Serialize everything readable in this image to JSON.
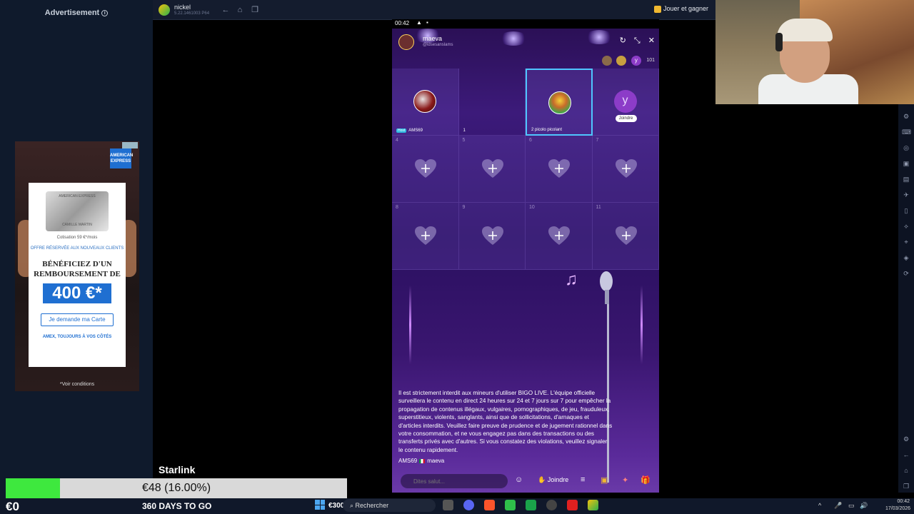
{
  "ad": {
    "label": "Advertisement",
    "brand": "AMERICAN EXPRESS",
    "card_brand": "AMERICAN EXPRESS",
    "card_holder": "CAMILLE MARTIN",
    "fee": "Cotisation 59 €*/mois",
    "offer": "OFFRE RÉSERVÉE AUX NOUVEAUX CLIENTS",
    "headline": "BÉNÉFICIEZ D'UN REMBOURSEMENT DE",
    "amount": "400 €*",
    "cta": "Je demande ma Carte",
    "tagline": "AMEX, TOUJOURS À VOS CÔTÉS",
    "conditions": "*Voir conditions"
  },
  "emulator": {
    "title": "nickel",
    "subtitle": "5.22.1461003 P64",
    "play_earn": "Jouer et gagner"
  },
  "phone": {
    "clock": "00:42",
    "host_name": "maeva",
    "host_id": "@ldsesanslams",
    "viewer_count": "101",
    "viewer_letter": "y",
    "seats": [
      {
        "num": "",
        "label": "AMS69",
        "host": "Host"
      },
      {
        "num": "",
        "label": "1"
      },
      {
        "num": "",
        "label": "2  picolo picolant"
      },
      {
        "num": "",
        "letter": "y",
        "join": "Joindre"
      },
      {
        "num": "4"
      },
      {
        "num": "5"
      },
      {
        "num": "6"
      },
      {
        "num": "7"
      },
      {
        "num": "8"
      },
      {
        "num": "9"
      },
      {
        "num": "10"
      },
      {
        "num": "11"
      }
    ],
    "notice": "Il est strictement interdit aux mineurs d'utiliser BIGO LIVE. L'équipe officielle surveillera le contenu en direct 24 heures sur 24 et 7 jours sur 7 pour empêcher la propagation de contenus illégaux, vulgaires, pornographiques, de jeu, frauduleux, superstitieux, violents, sanglants, ainsi que de sollicitations, d'arnaques et d'articles interdits. Veuillez faire preuve de prudence et de jugement rationnel dans votre consommation, et ne vous engagez pas dans des transactions ou des transferts privés avec d'autres. Si vous constatez des violations, veuillez signaler le contenu rapidement.",
    "chat_user": "AMS69",
    "chat_text": "maeva",
    "input_placeholder": "Dites salut...",
    "join_label": "Joindre"
  },
  "overlay": {
    "sponsor": "Starlink",
    "progress_text": "€48 (16.00%)",
    "progress_fraction": 0.16,
    "balance": "€0",
    "countdown": "360 DAYS TO GO",
    "taskbar_amount": "€300"
  },
  "taskbar": {
    "search_placeholder": "Rechercher",
    "time": "00:42",
    "date": "17/03/2026"
  },
  "colors": {
    "progress_fill": "#3ee83e",
    "phone_purple": "#3c1a7a",
    "selected_seat": "#4fc6ff"
  }
}
